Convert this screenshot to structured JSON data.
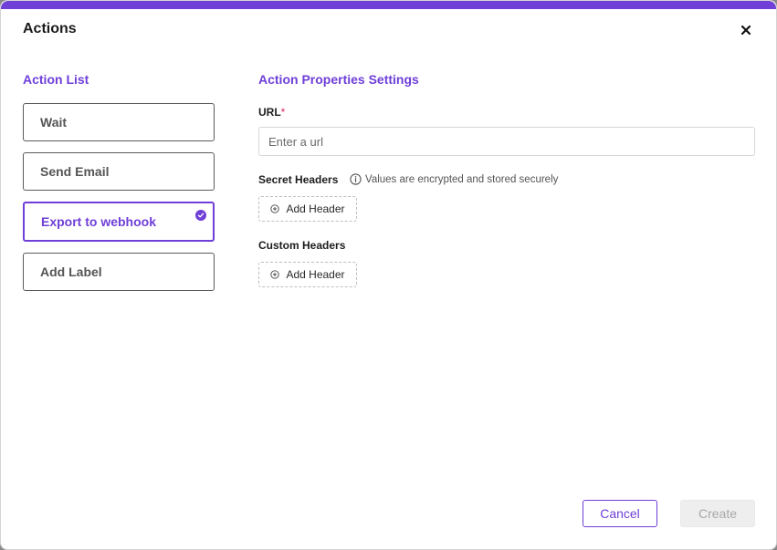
{
  "modal": {
    "title": "Actions",
    "close_icon": "close-icon",
    "accent_color": "#6f3fd8"
  },
  "action_list": {
    "title": "Action List",
    "items": [
      {
        "label": "Wait",
        "selected": false
      },
      {
        "label": "Send Email",
        "selected": false
      },
      {
        "label": "Export to webhook",
        "selected": true
      },
      {
        "label": "Add Label",
        "selected": false
      }
    ]
  },
  "properties": {
    "title": "Action Properties Settings",
    "url": {
      "label": "URL",
      "required_mark": "*",
      "value": "",
      "placeholder": "Enter a url"
    },
    "secret_headers": {
      "label": "Secret Headers",
      "hint": "Values are encrypted and stored securely",
      "add_label": "Add Header"
    },
    "custom_headers": {
      "label": "Custom Headers",
      "add_label": "Add Header"
    }
  },
  "footer": {
    "cancel_label": "Cancel",
    "create_label": "Create"
  }
}
